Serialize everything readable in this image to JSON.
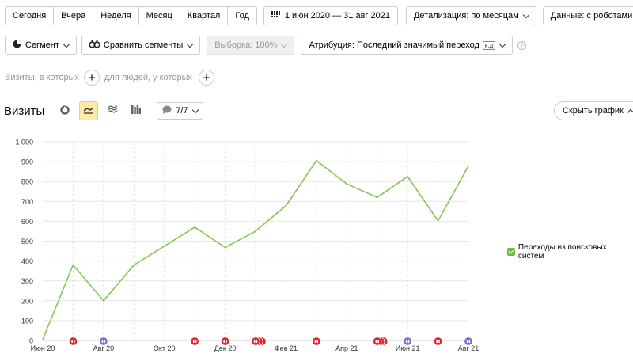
{
  "period": {
    "presets": [
      "Сегодня",
      "Вчера",
      "Неделя",
      "Месяц",
      "Квартал",
      "Год"
    ],
    "date_range": "1 июн 2020 — 31 авг 2021",
    "detail": "Детализация: по месяцам",
    "data": "Данные: с роботами"
  },
  "segment": {
    "segment_label": "Сегмент",
    "compare_label": "Сравнить сегменты",
    "sample_label": "Выборка: 100%",
    "attribution_label": "Атрибуция: Последний значимый переход",
    "attribution_badge": "к.д"
  },
  "conditions": {
    "visits_label": "Визиты, в которых",
    "people_label": "для людей, у которых"
  },
  "chart_header": {
    "title": "Визиты",
    "metrics_count": "7/7",
    "hide_chart": "Скрыть график"
  },
  "chart_data": {
    "type": "line",
    "x": [
      "Июн 20",
      "Июл 20",
      "Авг 20",
      "Сен 20",
      "Окт 20",
      "Ноя 20",
      "Дек 20",
      "Янв 21",
      "Фев 21",
      "Мар 21",
      "Апр 21",
      "Май 21",
      "Июн 21",
      "Июл 21",
      "Авг 21"
    ],
    "x_tick_labels": [
      "Июн 20",
      "Авг 20",
      "Окт 20",
      "Дек 20",
      "Фев 21",
      "Апр 21",
      "Июн 21",
      "Авг 21"
    ],
    "y_tick_labels": [
      "0",
      "100",
      "200",
      "300",
      "400",
      "500",
      "600",
      "700",
      "800",
      "900",
      "1 000"
    ],
    "ylim": [
      0,
      1000
    ],
    "series": [
      {
        "name": "Переходы из поисковых систем",
        "color": "#86c55a",
        "values": [
          5,
          380,
          200,
          380,
          475,
          570,
          468,
          550,
          678,
          905,
          788,
          720,
          825,
          602,
          878
        ]
      }
    ],
    "grid": true,
    "legend_position": "right",
    "annotation_markers": [
      {
        "x": "Июл 20",
        "kind": "red",
        "count": 1
      },
      {
        "x": "Авг 20",
        "kind": "purple",
        "count": 1
      },
      {
        "x": "Ноя 20",
        "kind": "red",
        "count": 1
      },
      {
        "x": "Дек 20",
        "kind": "red",
        "count": 1
      },
      {
        "x": "Янв 21",
        "kind": "red",
        "count": 3
      },
      {
        "x": "Мар 21",
        "kind": "red",
        "count": 1
      },
      {
        "x": "Май 21",
        "kind": "red",
        "count": 3
      },
      {
        "x": "Июн 21",
        "kind": "purple",
        "count": 1
      },
      {
        "x": "Июл 21",
        "kind": "red",
        "count": 1
      },
      {
        "x": "Авг 21",
        "kind": "purple",
        "count": 1
      }
    ]
  }
}
